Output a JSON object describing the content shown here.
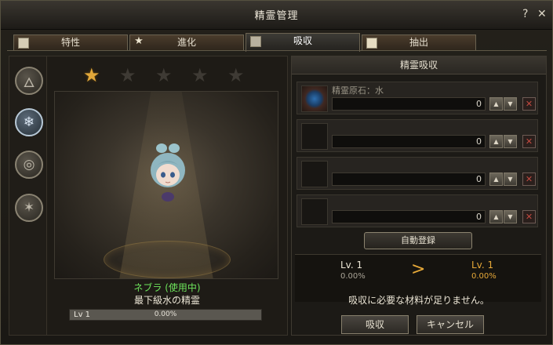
{
  "window": {
    "title": "精霊管理",
    "help_label": "?",
    "close_label": "✕"
  },
  "tabs": [
    {
      "label": "特性",
      "icon": "chart-arrow-icon"
    },
    {
      "label": "進化",
      "icon": "star-icon"
    },
    {
      "label": "吸収",
      "icon": "absorb-icon"
    },
    {
      "label": "抽出",
      "icon": "extract-icon"
    }
  ],
  "active_tab": "吸収",
  "sidebar": {
    "elements": [
      "fire-icon",
      "water-icon",
      "wind-icon",
      "earth-icon"
    ],
    "active": "water-icon"
  },
  "spirit": {
    "stars": {
      "filled": 1,
      "total": 5
    },
    "name": "ネブラ",
    "status": "(使用中)",
    "name_line": "ネブラ (使用中)",
    "description": "最下級水の精霊",
    "level_label": "Lv 1",
    "exp_pct": "0.00%",
    "exp_fraction": 0
  },
  "absorb_panel": {
    "title": "精霊吸収",
    "slots": [
      {
        "name": "精霊原石：水",
        "qty": "0",
        "has_item": true
      },
      {
        "name": "",
        "qty": "0",
        "has_item": false
      },
      {
        "name": "",
        "qty": "0",
        "has_item": false
      },
      {
        "name": "",
        "qty": "0",
        "has_item": false
      }
    ],
    "auto_register_label": "自動登録",
    "current_level": "Lv. 1",
    "current_pct": "0.00%",
    "next_level": "Lv. 1",
    "next_pct": "0.00%",
    "arrow": ">",
    "message": "吸収に必要な材料が足りません。"
  },
  "buttons": {
    "absorb_label": "吸収",
    "cancel_label": "キャンセル"
  }
}
